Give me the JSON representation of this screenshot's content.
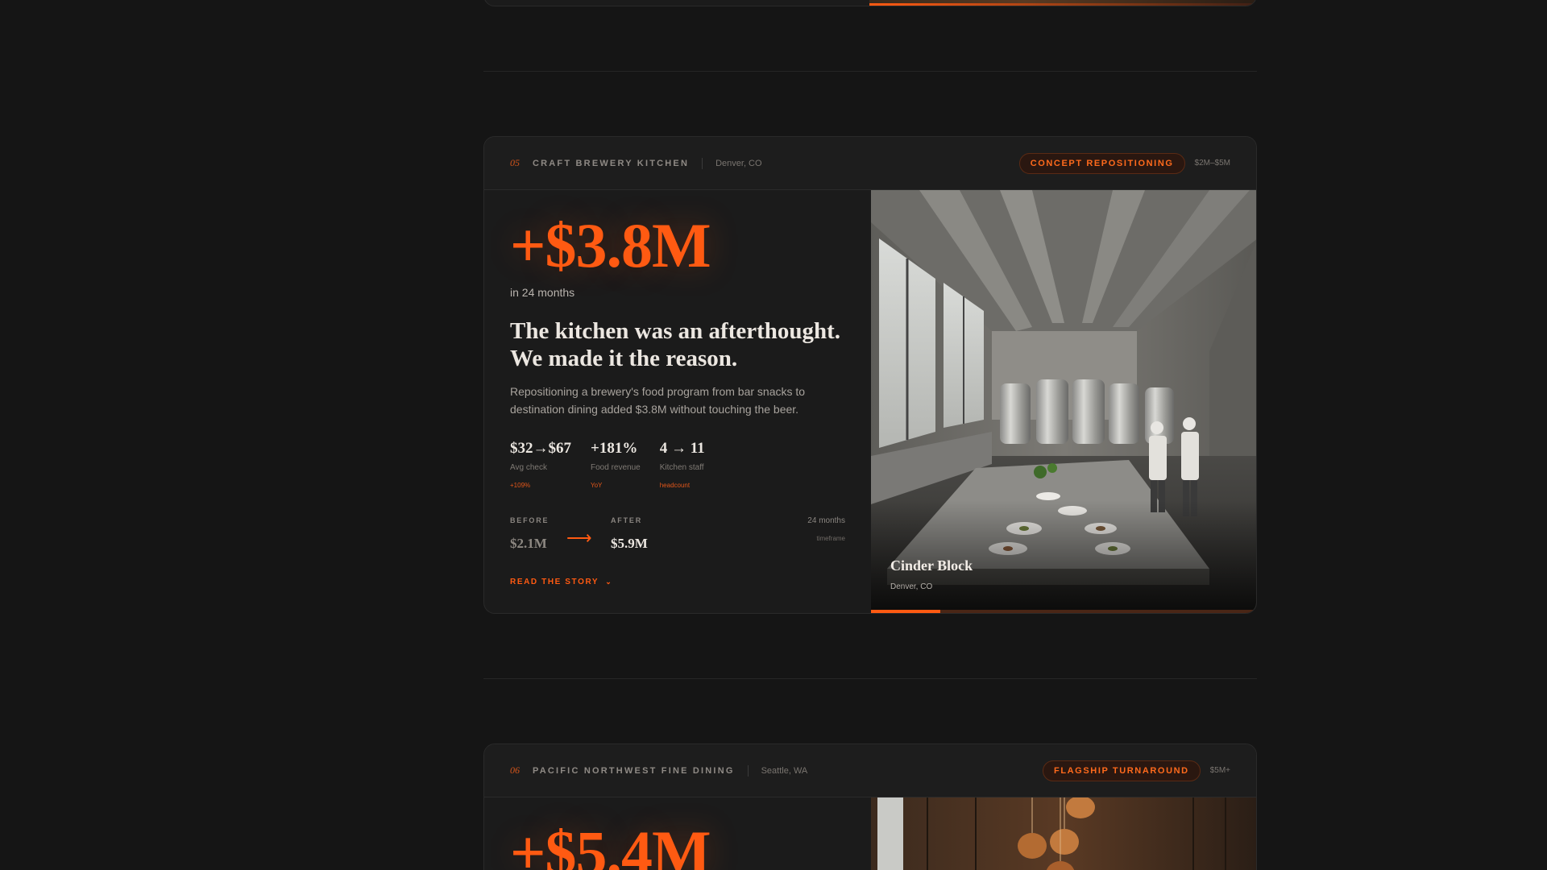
{
  "cards": [
    {
      "number": "05",
      "category": "CRAFT BREWERY KITCHEN",
      "location": "Denver, CO",
      "tag": "CONCEPT REPOSITIONING",
      "range": "$2M–$5M",
      "big_value": "+$3.8M",
      "period": "in 24 months",
      "headline_line1": "The kitchen was an afterthought.",
      "headline_line2": "We made it the reason.",
      "description": "Repositioning a brewery's food program from bar snacks to destination dining added $3.8M without touching the beer.",
      "metrics": [
        {
          "value": "$32→$67",
          "label": "Avg check",
          "sub": "+109%"
        },
        {
          "value": "+181%",
          "label": "Food revenue",
          "sub": "YoY"
        },
        {
          "value": "4 → 11",
          "label": "Kitchen staff",
          "sub": "headcount"
        }
      ],
      "before_label": "BEFORE",
      "before_value": "$2.1M",
      "after_label": "AFTER",
      "after_value": "$5.9M",
      "timeframe_value": "24 months",
      "timeframe_label": "timeframe",
      "read_label": "READ THE STORY",
      "image_title": "Cinder Block",
      "image_subtitle": "Denver, CO",
      "image_progress": 0.18
    },
    {
      "number": "06",
      "category": "PACIFIC NORTHWEST FINE DINING",
      "location": "Seattle, WA",
      "tag": "FLAGSHIP TURNAROUND",
      "range": "$5M+",
      "big_value": "+$5.4M"
    }
  ],
  "colors": {
    "accent": "#ff5a12",
    "background": "#151515",
    "card": "#1b1b1b"
  },
  "icons": {
    "arrow": "long-right-arrow-icon",
    "chevron": "chevron-down-icon"
  }
}
